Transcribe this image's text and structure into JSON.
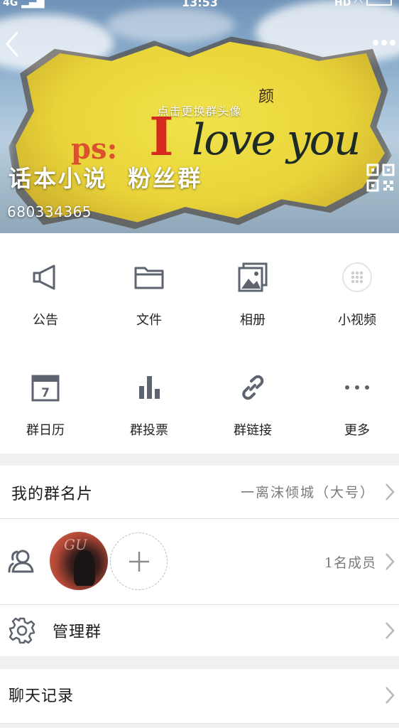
{
  "status_bar": {
    "network": "4G",
    "time": "13:53",
    "hd": "HD"
  },
  "header": {
    "change_avatar_hint": "点击更换群头像",
    "group_name": "话本小说  粉丝群",
    "group_id": "680334365",
    "banner_image_text": {
      "ps": "ps:",
      "i": "I",
      "love_you": "love you",
      "small": "颜"
    }
  },
  "functions": [
    {
      "label": "公告",
      "icon": "announcement-icon"
    },
    {
      "label": "文件",
      "icon": "folder-icon"
    },
    {
      "label": "相册",
      "icon": "album-icon"
    },
    {
      "label": "小视频",
      "icon": "video-icon"
    },
    {
      "label": "群日历",
      "icon": "calendar-icon"
    },
    {
      "label": "群投票",
      "icon": "vote-icon"
    },
    {
      "label": "群链接",
      "icon": "link-icon"
    },
    {
      "label": "更多",
      "icon": "more-icon"
    }
  ],
  "calendar_day": "7",
  "card": {
    "title": "我的群名片",
    "value": "一离沫倾城（大号）"
  },
  "members": {
    "count_text": "1名成员",
    "avatar_text": "GU"
  },
  "manage": {
    "title": "管理群"
  },
  "chat_history": {
    "title": "聊天记录"
  },
  "colors": {
    "icon_gray": "#5d6470",
    "divider": "#e2e2e4",
    "page_bg": "#f0f0f2"
  }
}
